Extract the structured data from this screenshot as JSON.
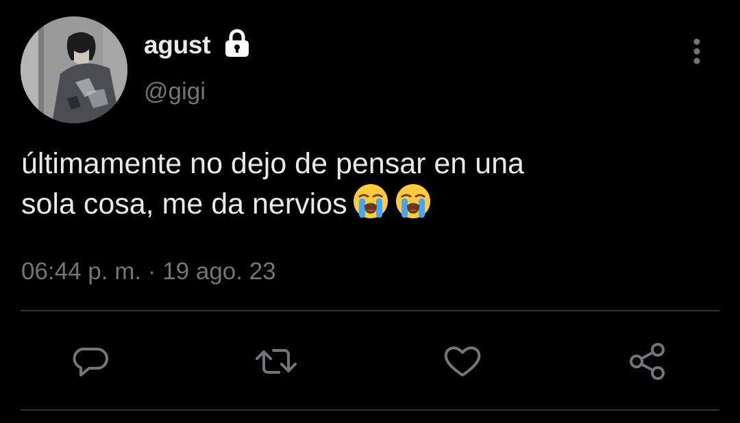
{
  "tweet": {
    "author": {
      "display_name": "agust",
      "handle": "@gigi",
      "protected_icon": "lock-icon"
    },
    "text_lines": [
      "últimamente no dejo de pensar en una",
      "sola cosa, me da nervios"
    ],
    "emojis": [
      "loudly-crying-face",
      "loudly-crying-face"
    ],
    "timestamp": "06:44 p. m. · 19 ago. 23"
  },
  "actions": [
    {
      "name": "reply",
      "icon": "comment-icon"
    },
    {
      "name": "retweet",
      "icon": "retweet-icon"
    },
    {
      "name": "like",
      "icon": "heart-icon"
    },
    {
      "name": "share",
      "icon": "share-icon"
    }
  ],
  "colors": {
    "background": "#000000",
    "text_primary": "#e7e9ea",
    "text_secondary": "#71767b",
    "divider": "#2f3336"
  }
}
